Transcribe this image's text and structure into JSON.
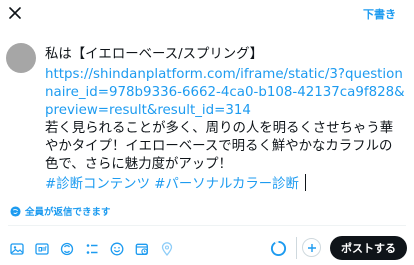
{
  "header": {
    "close_icon": "close-icon",
    "drafts_label": "下書き"
  },
  "tweet": {
    "title": "私は【イエローベース/スプリング】",
    "link": "https://shindanplatform.com/iframe/static/3?questionnaire_id=978b9336-6662-4ca0-b108-42137ca9f828&preview=result&result_id=314",
    "body": "若く見られることが多く、周りの人を明るくさせちゃう華やかタイプ！イエローベースで明るく鮮やかなカラフルの色で、さらに魅力度がアップ！",
    "hashtags": "#診断コンテンツ #パーソナルカラー診断"
  },
  "reply_setting": {
    "icon": "globe-icon",
    "label": "全員が返信できます"
  },
  "toolbar": {
    "icons": [
      "image-icon",
      "gif-icon",
      "poll-icon",
      "list-icon",
      "emoji-icon",
      "schedule-icon",
      "location-icon"
    ]
  },
  "actions": {
    "post_label": "ポストする"
  },
  "colors": {
    "accent": "#1d9bf0",
    "text": "#0f1419",
    "post_button": "#0f1419",
    "avatar": "#a6a6a6"
  }
}
